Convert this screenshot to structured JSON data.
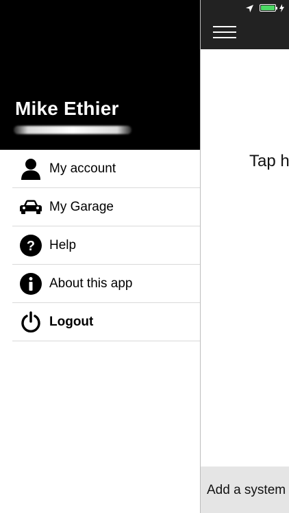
{
  "drawer": {
    "profile": {
      "name": "Mike Ethier"
    },
    "menu": [
      {
        "label": "My account",
        "icon": "person-icon"
      },
      {
        "label": "My Garage",
        "icon": "car-icon"
      },
      {
        "label": "Help",
        "icon": "question-circle-icon"
      },
      {
        "label": "About this app",
        "icon": "info-circle-icon"
      },
      {
        "label": "Logout",
        "icon": "power-icon"
      }
    ]
  },
  "main": {
    "hint_text": "Tap h",
    "bottom_action": "Add a system"
  },
  "status_bar": {
    "battery_color": "#4cd964"
  },
  "colors": {
    "drawer_header": "#000000",
    "topbar": "#222222",
    "bottombar": "#e5e5e5"
  }
}
